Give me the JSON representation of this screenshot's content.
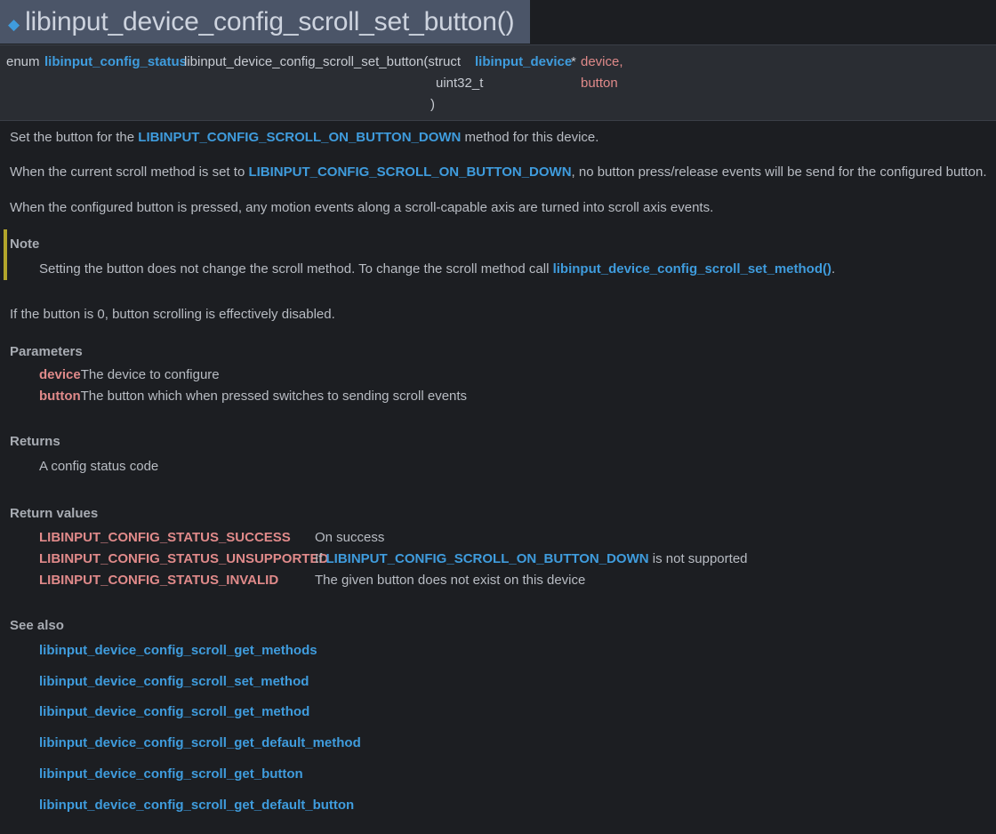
{
  "title": "libinput_device_config_scroll_set_button()",
  "prototype": {
    "enum_kw": "enum",
    "return_type": "libinput_config_status",
    "func_name": "libinput_device_config_scroll_set_button(struct",
    "param1_type": "libinput_device",
    "param1_star": "*",
    "param1_name": "device,",
    "param2_type": "uint32_t",
    "param2_name": "button",
    "close_paren": ")"
  },
  "description": {
    "p1_before": "Set the button for the",
    "p1_link": "LIBINPUT_CONFIG_SCROLL_ON_BUTTON_DOWN",
    "p1_after": "method for this device.",
    "p2_before": "When the current scroll method is set to",
    "p2_link": "LIBINPUT_CONFIG_SCROLL_ON_BUTTON_DOWN",
    "p2_after": ", no button press/release events will be send for the configured button.",
    "p3": "When the configured button is pressed, any motion events along a scroll-capable axis are turned into scroll axis events."
  },
  "note": {
    "heading": "Note",
    "text_before": "Setting the button does not change the scroll method. To change the scroll method call",
    "link": "libinput_device_config_scroll_set_method()",
    "text_after": "."
  },
  "disabled_text": "If the button is 0, button scrolling is effectively disabled.",
  "parameters": {
    "heading": "Parameters",
    "items": [
      {
        "name": "device",
        "desc": "The device to configure"
      },
      {
        "name": "button",
        "desc": "The button which when pressed switches to sending scroll events"
      }
    ]
  },
  "returns": {
    "heading": "Returns",
    "text": "A config status code"
  },
  "return_values": {
    "heading": "Return values",
    "items": [
      {
        "name": "LIBINPUT_CONFIG_STATUS_SUCCESS",
        "desc": "On success"
      },
      {
        "name": "LIBINPUT_CONFIG_STATUS_UNSUPPORTED",
        "desc_before": "If",
        "desc_link": "LIBINPUT_CONFIG_SCROLL_ON_BUTTON_DOWN",
        "desc_after": "is not supported"
      },
      {
        "name": "LIBINPUT_CONFIG_STATUS_INVALID",
        "desc": "The given button does not exist on this device"
      }
    ]
  },
  "see_also": {
    "heading": "See also",
    "links": [
      "libinput_device_config_scroll_get_methods",
      "libinput_device_config_scroll_set_method",
      "libinput_device_config_scroll_get_method",
      "libinput_device_config_scroll_get_default_method",
      "libinput_device_config_scroll_get_button",
      "libinput_device_config_scroll_get_default_button"
    ]
  },
  "colors": {
    "background": "#1c1e22",
    "title_bg": "#4b5568",
    "link": "#3f9cdd",
    "param": "#e08a8a",
    "note_bar": "#b2a52b"
  }
}
